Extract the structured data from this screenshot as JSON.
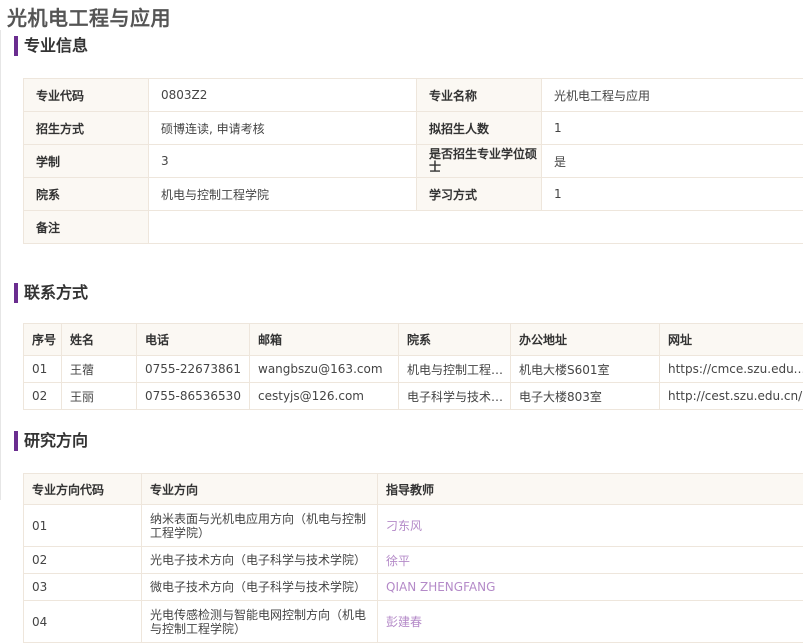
{
  "page_title": "光机电工程与应用",
  "sections": {
    "info": "专业信息",
    "contact": "联系方式",
    "research": "研究方向"
  },
  "info": {
    "code_label": "专业代码",
    "code_value": "0803Z2",
    "name_label": "专业名称",
    "name_value": "光机电工程与应用",
    "enroll_label": "招生方式",
    "enroll_value": "硕博连读, 申请考核",
    "quota_label": "拟招生人数",
    "quota_value": "1",
    "duration_label": "学制",
    "duration_value": "3",
    "professional_label": "是否招生专业学位硕士",
    "professional_value": "是",
    "dept_label": "院系",
    "dept_value": "机电与控制工程学院",
    "study_label": "学习方式",
    "study_value": "1",
    "remark_label": "备注",
    "remark_value": ""
  },
  "contact": {
    "headers": [
      "序号",
      "姓名",
      "电话",
      "邮箱",
      "院系",
      "办公地址",
      "网址"
    ],
    "rows": [
      [
        "01",
        "王蓿",
        "0755-22673861",
        "wangbszu@163.com",
        "机电与控制工程学院",
        "机电大楼S601室",
        "https://cmce.szu.edu.cn/"
      ],
      [
        "02",
        "王丽",
        "0755-86536530",
        "cestyjs@126.com",
        "电子科学与技术学院",
        "电子大楼803室",
        "http://cest.szu.edu.cn/"
      ]
    ]
  },
  "research": {
    "headers": [
      "专业方向代码",
      "专业方向",
      "指导教师"
    ],
    "rows": [
      [
        "01",
        "纳米表面与光机电应用方向（机电与控制工程学院）",
        "刁东风"
      ],
      [
        "02",
        "光电子技术方向（电子科学与技术学院）",
        "徐平"
      ],
      [
        "03",
        "微电子技术方向（电子科学与技术学院）",
        "QIAN ZHENGFANG"
      ],
      [
        "04",
        "光电传感检测与智能电网控制方向（机电与控制工程学院）",
        "彭建春"
      ]
    ]
  },
  "colors": {
    "accent": "#6a2d8f",
    "label_bg": "#fbf8f3",
    "border": "#eee6dc",
    "teacher_link": "#b48ac8"
  }
}
